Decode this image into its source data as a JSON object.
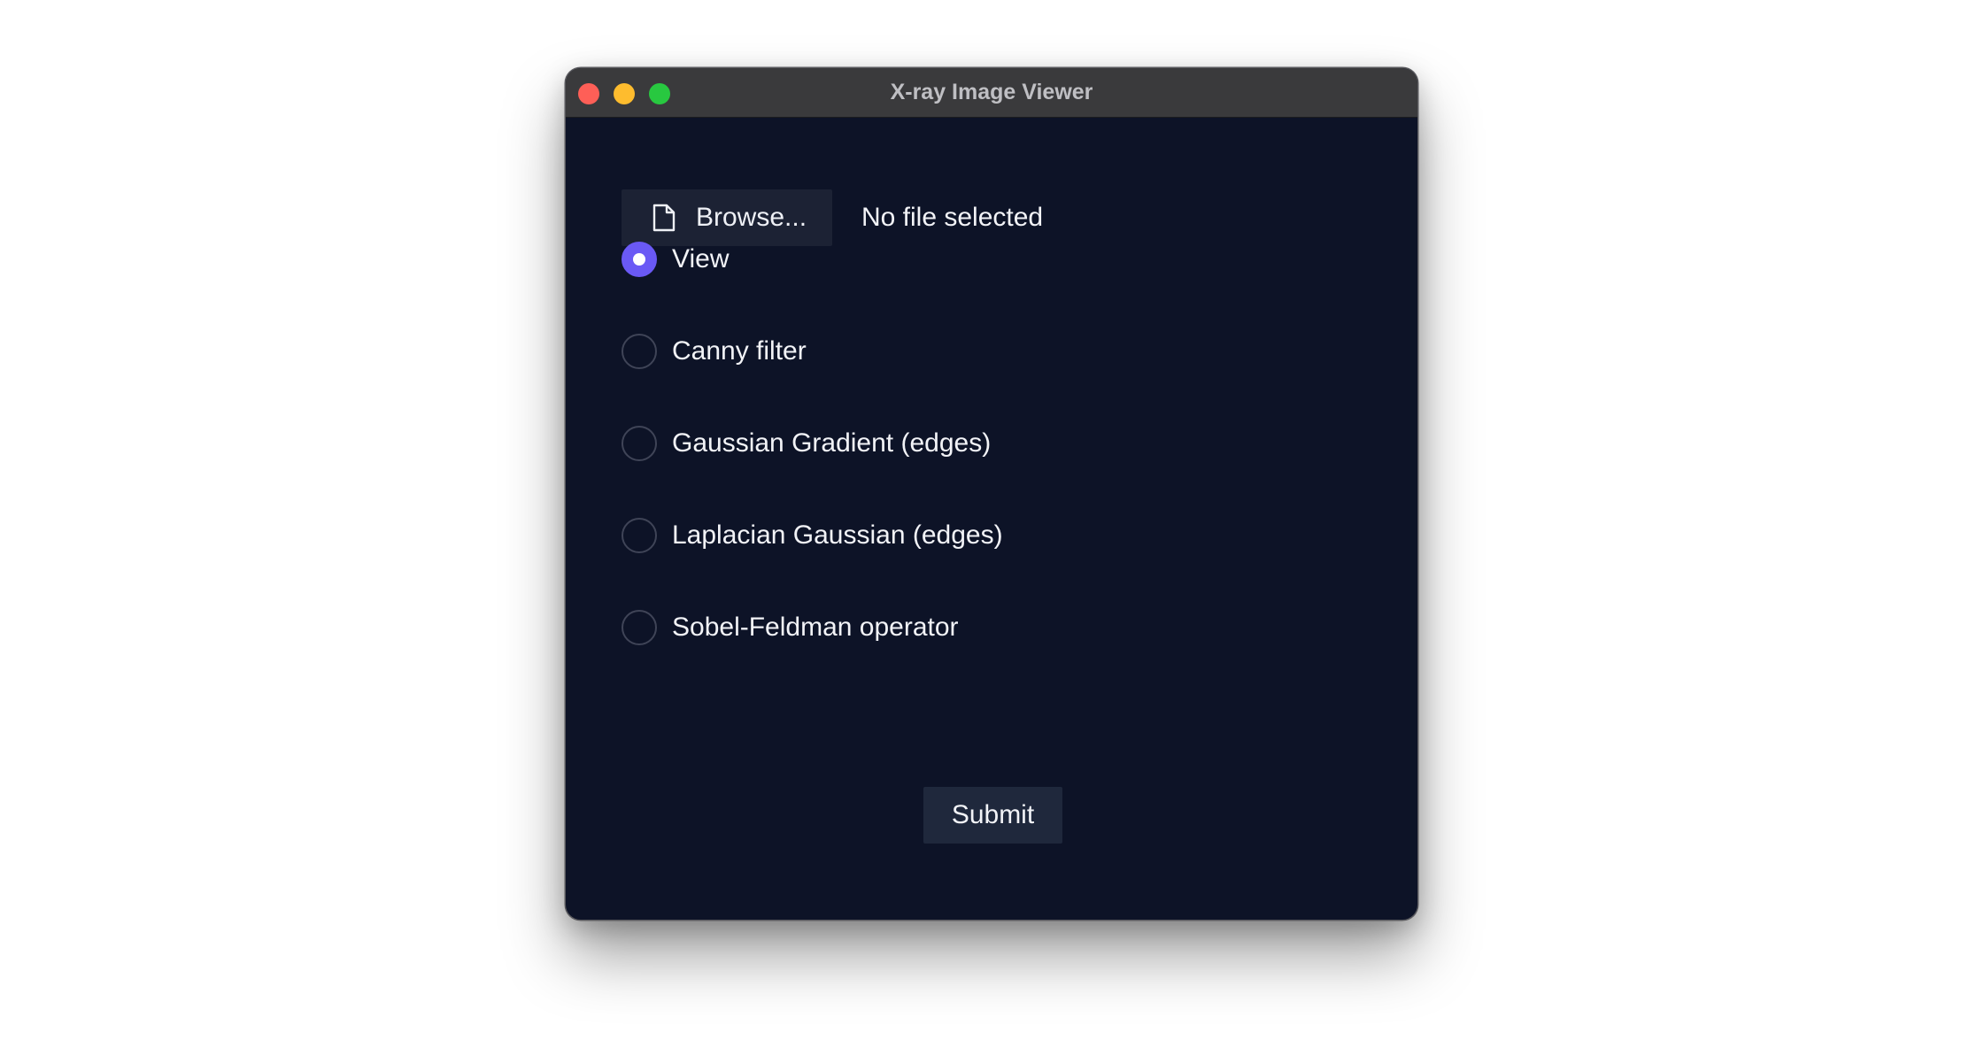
{
  "window": {
    "title": "X-ray Image Viewer"
  },
  "file_picker": {
    "button_label": "Browse...",
    "status": "No file selected",
    "icon": "file-icon"
  },
  "modes": [
    {
      "label": "View",
      "checked": true
    },
    {
      "label": "Canny filter",
      "checked": false
    },
    {
      "label": "Gaussian Gradient (edges)",
      "checked": false
    },
    {
      "label": "Laplacian Gaussian (edges)",
      "checked": false
    },
    {
      "label": "Sobel-Feldman operator",
      "checked": false
    }
  ],
  "submit": {
    "label": "Submit"
  },
  "colors": {
    "window_bg": "#0d1327",
    "titlebar_bg": "#3a3a3c",
    "accent": "#6a59f5",
    "button_bg": "#1c2234",
    "close": "#fe5f57",
    "minimize": "#febc2e",
    "maximize": "#28c840"
  }
}
